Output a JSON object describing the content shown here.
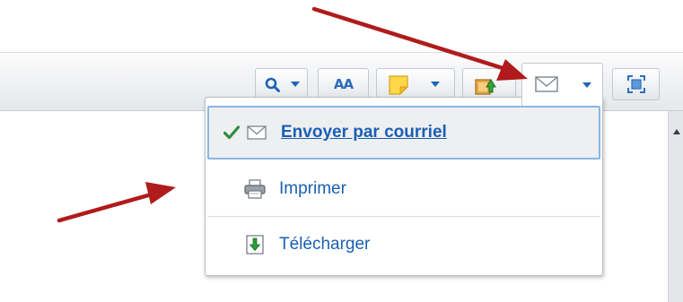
{
  "toolbar": {
    "font_size_label": "AA"
  },
  "menu": {
    "items": [
      {
        "label": "Envoyer par courriel",
        "icon": "envelope-icon",
        "selected": true
      },
      {
        "label": "Imprimer",
        "icon": "printer-icon",
        "selected": false
      },
      {
        "label": "Télécharger",
        "icon": "download-icon",
        "selected": false
      }
    ]
  },
  "colors": {
    "link_blue": "#1a5fb4",
    "selection_border": "#89b7e6",
    "check_green": "#2e8b3c",
    "annotation_red": "#b01b1b"
  }
}
